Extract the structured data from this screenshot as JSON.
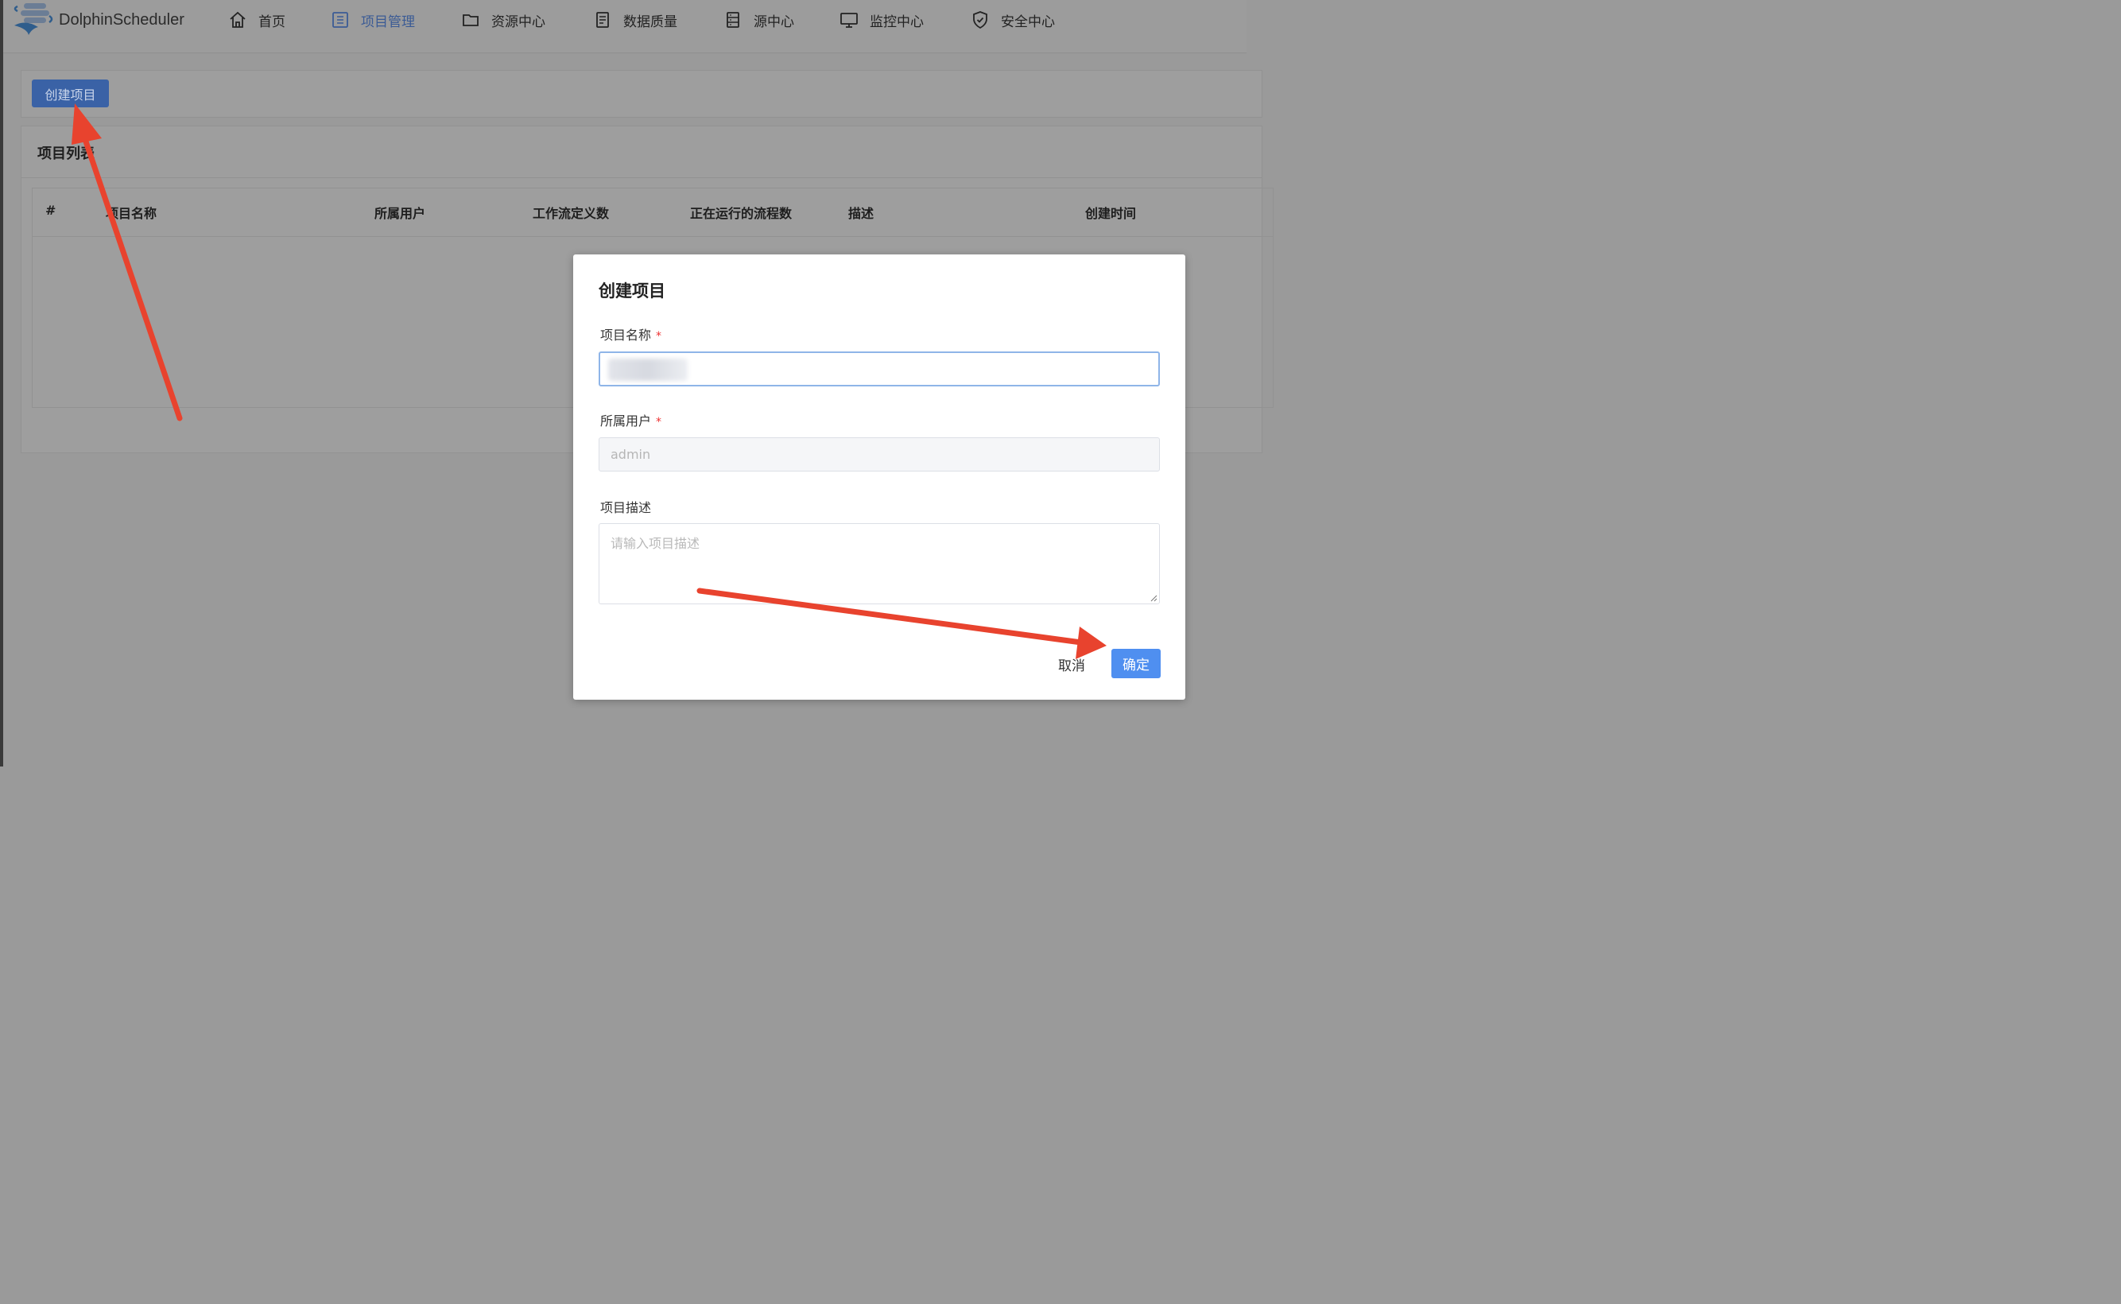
{
  "app": {
    "name": "DolphinScheduler"
  },
  "nav": {
    "home": "首页",
    "projects": "项目管理",
    "resources": "资源中心",
    "data_quality": "数据质量",
    "datasource": "源中心",
    "monitor": "监控中心",
    "security": "安全中心",
    "active": "项目管理"
  },
  "toolbar": {
    "create_project": "创建项目"
  },
  "project_list": {
    "title": "项目列表",
    "columns": [
      "#",
      "项目名称",
      "所属用户",
      "工作流定义数",
      "正在运行的流程数",
      "描述",
      "创建时间"
    ],
    "rows": []
  },
  "modal": {
    "title": "创建项目",
    "name_label": "项目名称",
    "owner_label": "所属用户",
    "owner_value": "admin",
    "description_label": "项目描述",
    "description_placeholder": "请输入项目描述",
    "required_mark": "*",
    "cancel": "取消",
    "confirm": "确定"
  },
  "colors": {
    "accent": "#4f8ff0",
    "annotation_arrow": "#e8432e"
  }
}
